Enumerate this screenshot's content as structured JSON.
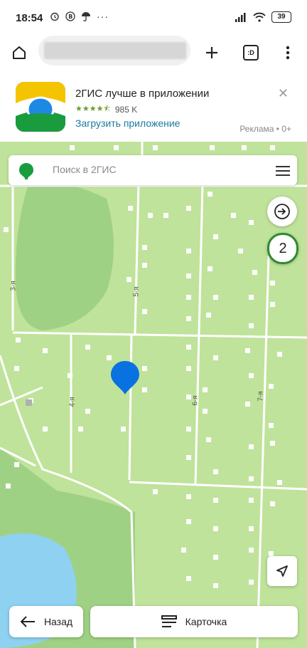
{
  "status_bar": {
    "time": "18:54",
    "battery": "39",
    "more_dots": "···"
  },
  "browser": {
    "home_icon": "home-icon",
    "new_tab_icon": "plus-icon",
    "tabs_label": ":D",
    "menu_icon": "more-vert-icon"
  },
  "ad": {
    "title": "2ГИС лучше в приложении",
    "stars": "★★★★⯪",
    "rating_count": "985 K",
    "install_link": "Загрузить приложение",
    "ad_label": "Реклама • 0+",
    "close_label": "✕",
    "brand_colors": {
      "yellow": "#f5c400",
      "green": "#1a9c3e",
      "blue": "#1e88e5"
    }
  },
  "map": {
    "search_placeholder": "Поиск в 2ГИС",
    "counter_badge": "2",
    "road_labels": [
      "3-я",
      "5-я",
      "4-я",
      "6-я",
      "7-я"
    ],
    "colors": {
      "land": "#bfe39a",
      "forest": "#9fd184",
      "water": "#8fd1f0",
      "road": "#ffffff",
      "marker": "#0a72e0"
    }
  },
  "bottom_bar": {
    "back_label": "Назад",
    "card_label": "Карточка"
  }
}
